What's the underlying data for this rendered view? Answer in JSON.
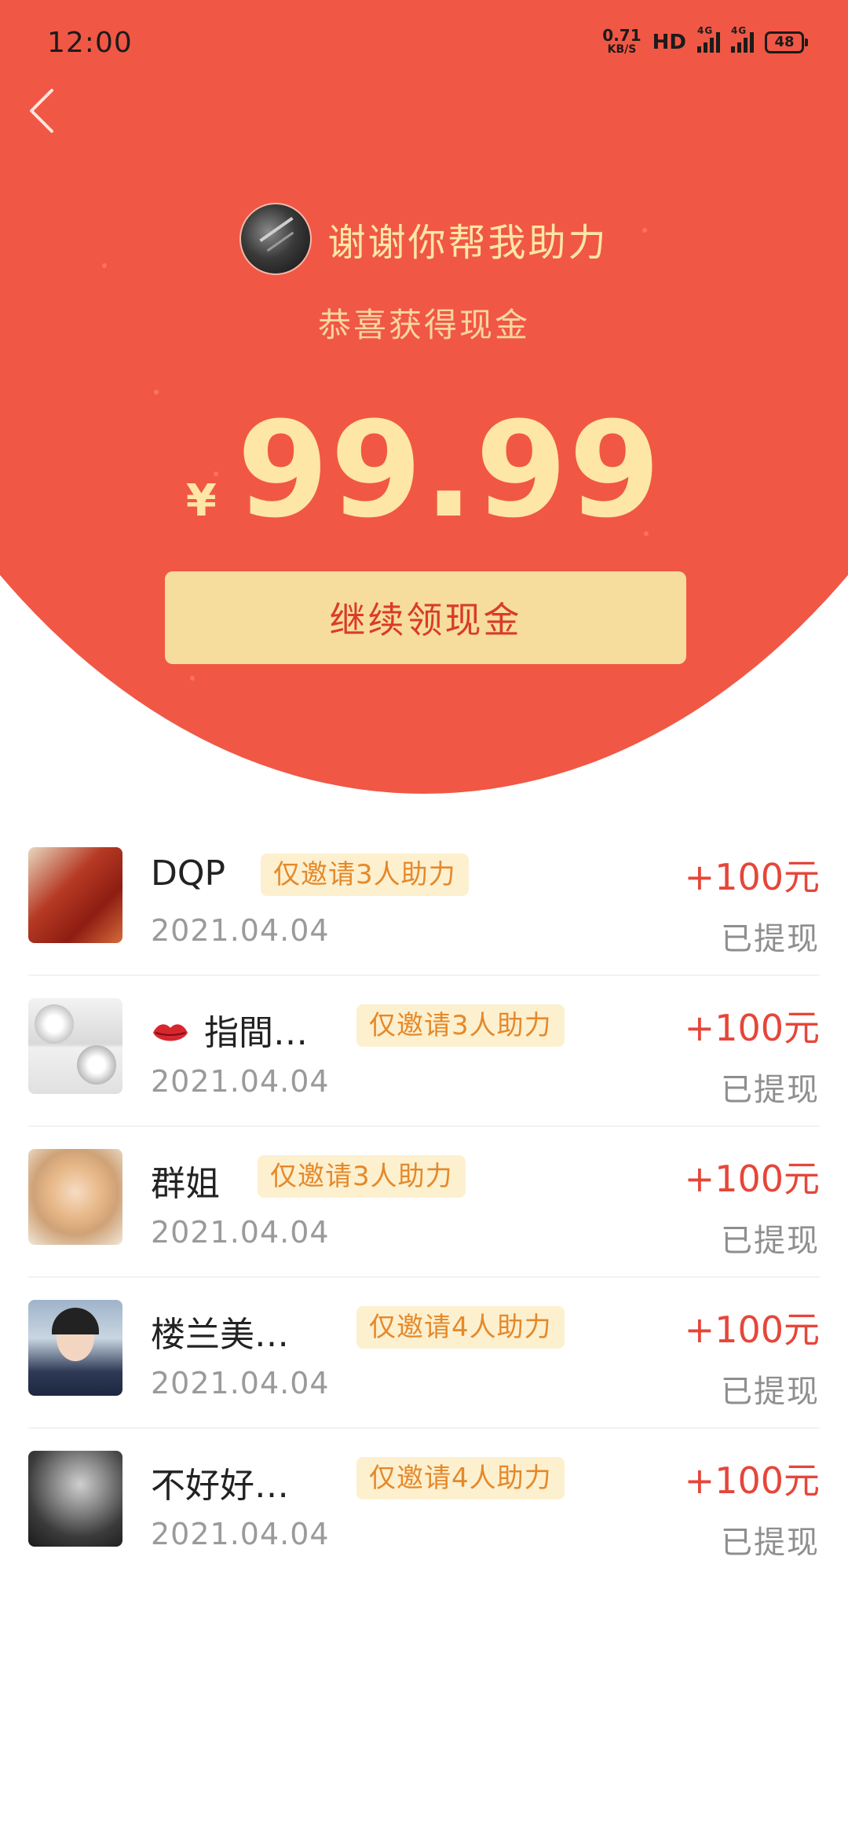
{
  "status_bar": {
    "time": "12:00",
    "net_speed_value": "0.71",
    "net_speed_unit": "KB/S",
    "hd": "HD",
    "signal1_tag": "4G",
    "signal2_tag": "4G",
    "battery": "48"
  },
  "header": {
    "inviter_text": "谢谢你帮我助力",
    "subtitle": "恭喜获得现金",
    "currency": "¥",
    "amount": "99.99",
    "cta_label": "继续领现金"
  },
  "icons": {
    "back": "chevron-left-icon",
    "lips": "kiss-lips-icon"
  },
  "colors": {
    "header_red": "#f15745",
    "gold_text": "#fde6a6",
    "cta_bg": "#f6dd9d",
    "cta_text": "#d93b2a",
    "tag_bg": "#fdf0cf",
    "tag_text": "#e5892a",
    "amount_red": "#e6463a"
  },
  "records": [
    {
      "name": "DQP",
      "tag": "仅邀请3人助力",
      "date": "2021.04.04",
      "amount": "+100元",
      "status": "已提现"
    },
    {
      "name": "指間…",
      "tag": "仅邀请3人助力",
      "date": "2021.04.04",
      "amount": "+100元",
      "status": "已提现"
    },
    {
      "name": "群姐",
      "tag": "仅邀请3人助力",
      "date": "2021.04.04",
      "amount": "+100元",
      "status": "已提现"
    },
    {
      "name": "楼兰美…",
      "tag": "仅邀请4人助力",
      "date": "2021.04.04",
      "amount": "+100元",
      "status": "已提现"
    },
    {
      "name": "不好好…",
      "tag": "仅邀请4人助力",
      "date": "2021.04.04",
      "amount": "+100元",
      "status": "已提现"
    }
  ]
}
